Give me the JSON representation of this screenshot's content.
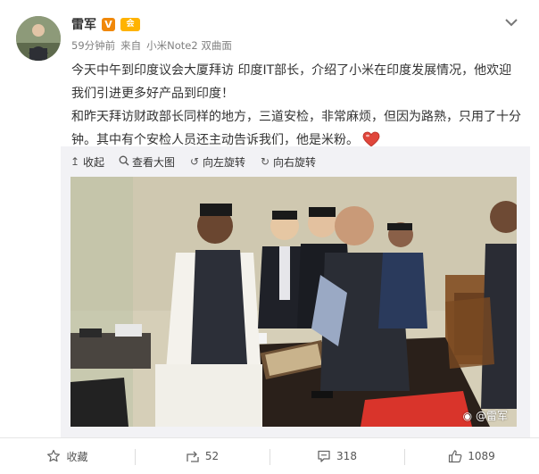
{
  "post": {
    "author": "雷军",
    "verified_badge": "V",
    "member_badge": "会",
    "time": "59分钟前",
    "source_prefix": "来自",
    "source": "小米Note2 双曲面",
    "paragraph1": "今天中午到印度议会大厦拜访 印度IT部长，介绍了小米在印度发展情况，他欢迎我们引进更多好产品到印度！",
    "paragraph2": "和昨天拜访财政部长同样的地方，三道安检，非常麻烦，但因为路熟，只用了十分钟。其中有个安检人员还主动告诉我们，他是米粉。"
  },
  "media_toolbar": {
    "collapse": "收起",
    "view_large": "查看大图",
    "rotate_left": "向左旋转",
    "rotate_right": "向右旋转"
  },
  "photo": {
    "watermark": "@雷军",
    "weibo_logo": "微博"
  },
  "actions": {
    "favorite": "收藏",
    "repost_count": "52",
    "comment_count": "318",
    "like_count": "1089"
  },
  "colors": {
    "verified_badge": "#f0880a",
    "member_badge": "#ffb300",
    "heart": "#e0463b"
  }
}
